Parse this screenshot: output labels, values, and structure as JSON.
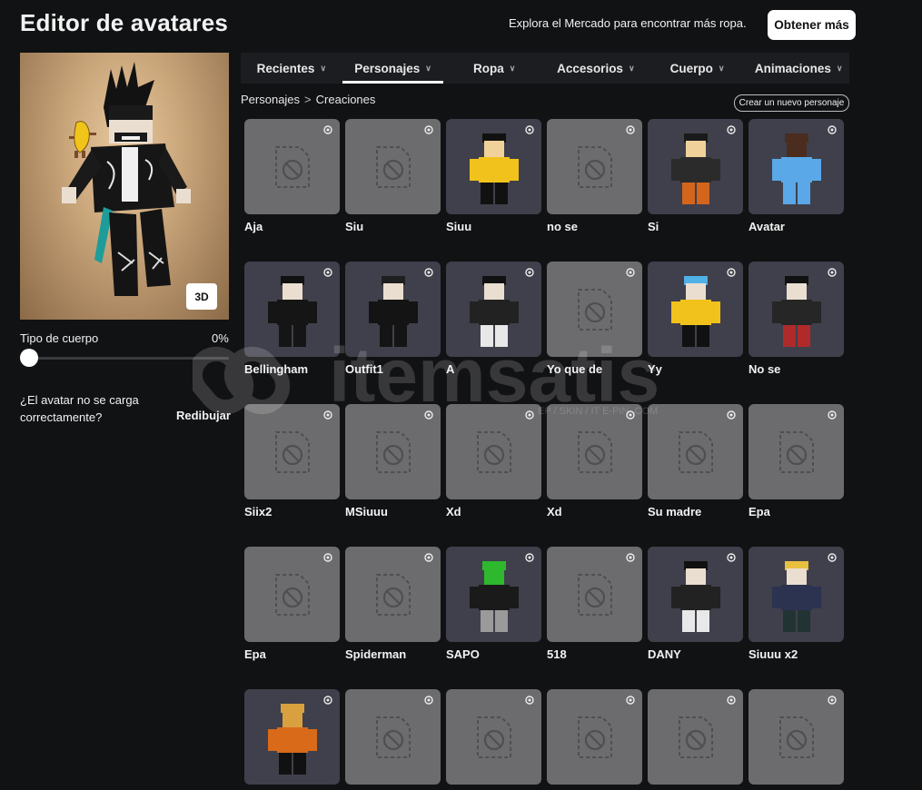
{
  "header": {
    "title": "Editor de avatares",
    "promo_text": "Explora el Mercado para encontrar más ropa.",
    "get_more_label": "Obtener más"
  },
  "preview": {
    "view_3d_label": "3D"
  },
  "body_type": {
    "label": "Tipo de cuerpo",
    "value": "0%",
    "slider_fraction": 0
  },
  "load_issue": {
    "question": "¿El avatar no se carga correctamente?",
    "redraw_label": "Redibujar"
  },
  "tabs": [
    {
      "label": "Recientes",
      "active": false
    },
    {
      "label": "Personajes",
      "active": true
    },
    {
      "label": "Ropa",
      "active": false
    },
    {
      "label": "Accesorios",
      "active": false
    },
    {
      "label": "Cuerpo",
      "active": false
    },
    {
      "label": "Animaciones",
      "active": false
    }
  ],
  "breadcrumb": {
    "parent": "Personajes",
    "separator": ">",
    "current": "Creaciones"
  },
  "new_character_label": "Crear un nuevo personaje",
  "watermark": {
    "text": "itemsatis",
    "sub": "EP / SKIN / IT   E-PIN   .COM"
  },
  "characters": [
    {
      "name": "Aja",
      "thumb": "empty"
    },
    {
      "name": "Siu",
      "thumb": "empty"
    },
    {
      "name": "Siuu",
      "thumb": "yellow"
    },
    {
      "name": "no se",
      "thumb": "empty"
    },
    {
      "name": "Si",
      "thumb": "black-orange"
    },
    {
      "name": "Avatar",
      "thumb": "blue"
    },
    {
      "name": "Bellingham",
      "thumb": "black-gold"
    },
    {
      "name": "Outfit1",
      "thumb": "black-hat"
    },
    {
      "name": "A",
      "thumb": "black-white"
    },
    {
      "name": "Yo que de",
      "thumb": "empty"
    },
    {
      "name": "Yy",
      "thumb": "yellow-cap"
    },
    {
      "name": "No se",
      "thumb": "black-red"
    },
    {
      "name": "Siix2",
      "thumb": "empty"
    },
    {
      "name": "MSiuuu",
      "thumb": "empty"
    },
    {
      "name": "Xd",
      "thumb": "empty"
    },
    {
      "name": "Xd",
      "thumb": "empty"
    },
    {
      "name": "Su madre",
      "thumb": "empty"
    },
    {
      "name": "Epa",
      "thumb": "empty"
    },
    {
      "name": "Epa",
      "thumb": "empty"
    },
    {
      "name": "Spiderman",
      "thumb": "empty"
    },
    {
      "name": "SAPO",
      "thumb": "frog"
    },
    {
      "name": "518",
      "thumb": "empty"
    },
    {
      "name": "DANY",
      "thumb": "black-white"
    },
    {
      "name": "Siuuu x2",
      "thumb": "horns"
    },
    {
      "name": "",
      "thumb": "tiger"
    },
    {
      "name": "",
      "thumb": "empty"
    },
    {
      "name": "",
      "thumb": "empty"
    },
    {
      "name": "",
      "thumb": "empty"
    },
    {
      "name": "",
      "thumb": "empty"
    },
    {
      "name": "",
      "thumb": "empty"
    }
  ],
  "colors": {
    "background": "#111214",
    "tab_bar": "#1c1d21",
    "empty_card": "#6c6c6e",
    "filled_card": "#3f404b",
    "accent": "#ffffff"
  }
}
